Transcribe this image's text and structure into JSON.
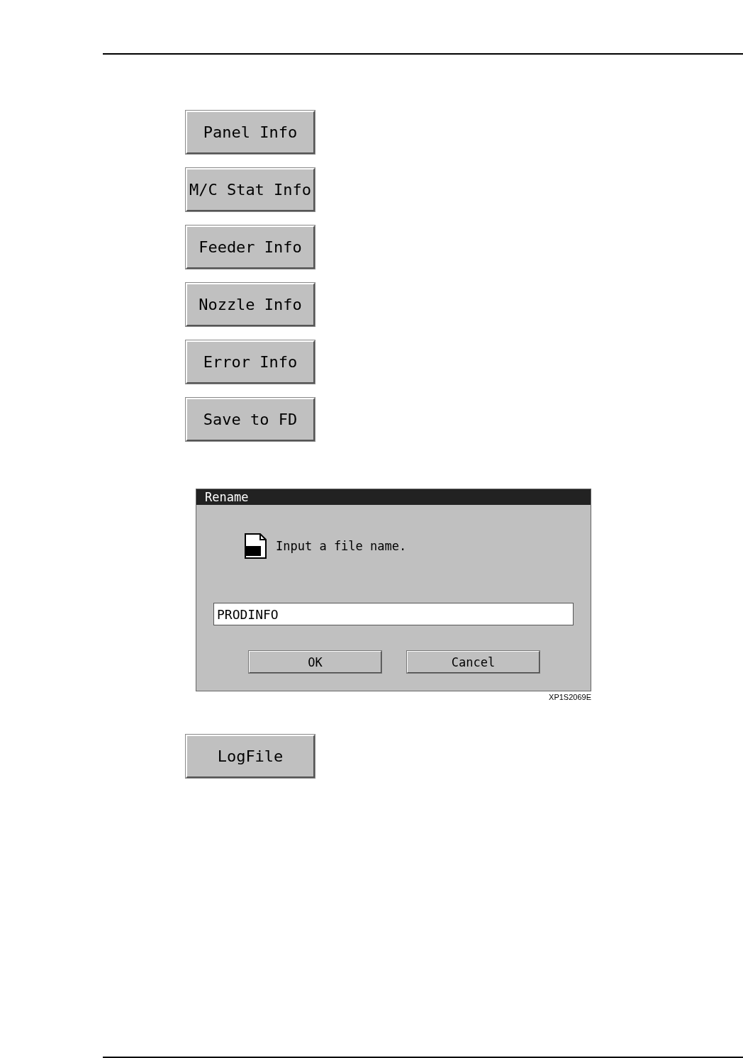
{
  "buttons": [
    {
      "label": "Panel Info"
    },
    {
      "label": "M/C Stat Info"
    },
    {
      "label": "Feeder Info"
    },
    {
      "label": "Nozzle Info"
    },
    {
      "label": "Error Info"
    },
    {
      "label": "Save to FD"
    }
  ],
  "dialog": {
    "title": "Rename",
    "message": "Input a file name.",
    "input": {
      "value": "PRODINFO"
    },
    "buttons": [
      "OK",
      "Cancel"
    ]
  },
  "figure_code": "XP1S2069E",
  "log_button": {
    "label": "LogFile"
  }
}
